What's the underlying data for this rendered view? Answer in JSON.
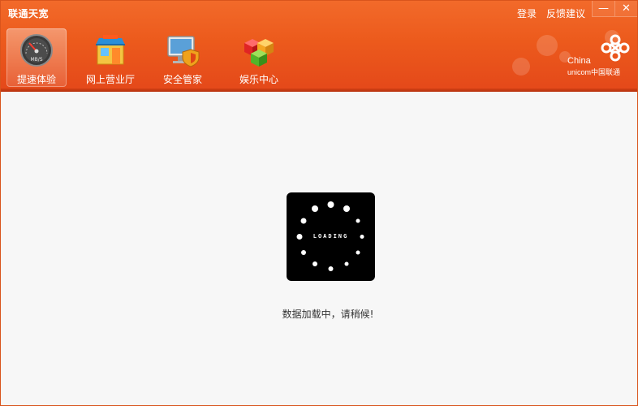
{
  "window": {
    "title": "联通天宽",
    "links": {
      "login": "登录",
      "feedback": "反馈建议"
    },
    "controls": {
      "minimize": "—",
      "close": "✕"
    }
  },
  "nav": {
    "items": [
      {
        "label": "提速体验",
        "icon": "speedometer-icon",
        "active": true,
        "gauge_text": "MB/S"
      },
      {
        "label": "网上营业厅",
        "icon": "store-icon",
        "active": false
      },
      {
        "label": "安全管家",
        "icon": "monitor-shield-icon",
        "active": false
      },
      {
        "label": "娱乐中心",
        "icon": "cubes-icon",
        "active": false
      }
    ]
  },
  "brand": {
    "line1": "China",
    "line2": "unicom中国联通"
  },
  "content": {
    "loading_label": "LOADING",
    "message": "数据加载中，请稍候!"
  },
  "colors": {
    "header": "#ec5a1c",
    "loader_bg": "#000000",
    "content_bg": "#f7f7f7"
  }
}
